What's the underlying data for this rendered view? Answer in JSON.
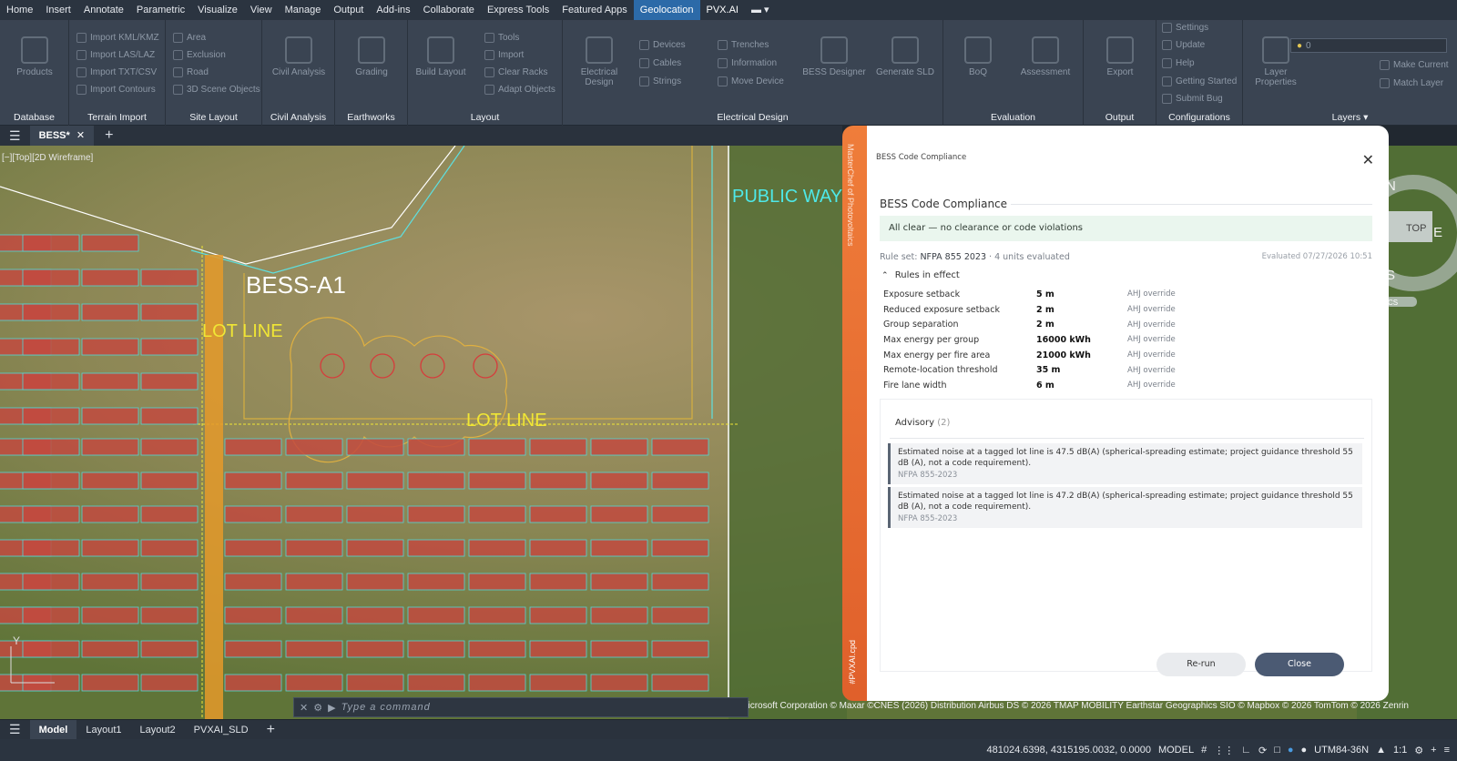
{
  "menu": {
    "tabs": [
      "Home",
      "Insert",
      "Annotate",
      "Parametric",
      "Visualize",
      "View",
      "Manage",
      "Output",
      "Add-ins",
      "Collaborate",
      "Express Tools",
      "Featured Apps",
      "Geolocation",
      "PVX.AI"
    ],
    "active": "Geolocation"
  },
  "ribbon": {
    "panels": [
      "Database",
      "Terrain Import",
      "Site Layout",
      "Civil Analysis",
      "Earthworks",
      "Layout",
      "Electrical Design",
      "Evaluation",
      "Output",
      "Configurations",
      "Layers"
    ],
    "products": "Products",
    "terrain": [
      "Import KML/KMZ",
      "Import LAS/LAZ",
      "Import TXT/CSV",
      "Import Contours"
    ],
    "site": [
      "Area",
      "Exclusion",
      "Road",
      "3D Scene Objects"
    ],
    "civil": "Civil Analysis",
    "grading": "Grading",
    "build": "Build Layout",
    "layout": [
      "Tools",
      "Import",
      "Clear Racks",
      "Adapt Objects"
    ],
    "elec_big": "Electrical Design",
    "elec1": [
      "Devices",
      "Cables",
      "Strings"
    ],
    "elec2": [
      "Trenches",
      "Information",
      "Move Device"
    ],
    "bess_designer": "BESS Designer",
    "gen_sld": "Generate SLD",
    "boq": "BoQ",
    "assessment": "Assessment",
    "export": "Export",
    "config": [
      "Settings",
      "Update",
      "Help",
      "Getting Started",
      "Submit Bug"
    ],
    "layer_props": "Layer Properties",
    "layer_value": "0",
    "make_current": "Make Current",
    "match_layer": "Match Layer"
  },
  "doc_tab": "BESS*",
  "viewport_label": "[−][Top][2D Wireframe]",
  "map_labels": {
    "bess": "BESS-A1",
    "lot1": "LOT LINE",
    "lot2": "LOT LINE",
    "public_way": "PUBLIC WAY"
  },
  "navcube": {
    "n": "N",
    "e": "E",
    "s": "S",
    "top": "TOP",
    "wcs": "CS"
  },
  "command_placeholder": "Type a command",
  "copyright": "© 2026 Microsoft Corporation © Maxar ©CNES (2026) Distribution Airbus DS © 2026 TMAP MOBILITY Earthstar Geographics  SIO © Mapbox © 2026 TomTom © 2026 Zenrin",
  "layout_tabs": [
    "Model",
    "Layout1",
    "Layout2",
    "PVXAI_SLD"
  ],
  "status": {
    "coords": "481024.6398, 4315195.0032, 0.0000",
    "model": "MODEL",
    "ucs": "UTM84-36N",
    "scale": "1:1"
  },
  "banner": {
    "text": "MasterChef of Photovoltaics",
    "tag": "#PVXAI.cpd"
  },
  "dialog": {
    "header": "BESS Code Compliance",
    "title": "BESS Code Compliance",
    "all_clear": "All clear — no clearance or code violations",
    "ruleset_label": "Rule set:",
    "ruleset": "NFPA 855 2023",
    "units": "·  4 units evaluated",
    "evaluated": "Evaluated 07/27/2026 10:51",
    "rules_header": "Rules in effect",
    "rules": [
      {
        "name": "Exposure setback",
        "value": "5 m",
        "source": "AHJ override"
      },
      {
        "name": "Reduced exposure setback",
        "value": "2 m",
        "source": "AHJ override"
      },
      {
        "name": "Group separation",
        "value": "2 m",
        "source": "AHJ override"
      },
      {
        "name": "Max energy per group",
        "value": "16000 kWh",
        "source": "AHJ override"
      },
      {
        "name": "Max energy per fire area",
        "value": "21000 kWh",
        "source": "AHJ override"
      },
      {
        "name": "Remote-location threshold",
        "value": "35 m",
        "source": "AHJ override"
      },
      {
        "name": "Fire lane width",
        "value": "6 m",
        "source": "AHJ override"
      }
    ],
    "advisory_title": "Advisory",
    "advisory_count": "(2)",
    "advisories": [
      {
        "text": "Estimated noise at a tagged lot line is 47.5 dB(A) (spherical-spreading estimate; project guidance threshold 55 dB (A), not a code requirement).",
        "source": "NFPA 855-2023"
      },
      {
        "text": "Estimated noise at a tagged lot line is 47.2 dB(A) (spherical-spreading estimate; project guidance threshold 55 dB (A), not a code requirement).",
        "source": "NFPA 855-2023"
      }
    ],
    "rerun": "Re-run",
    "close": "Close"
  }
}
